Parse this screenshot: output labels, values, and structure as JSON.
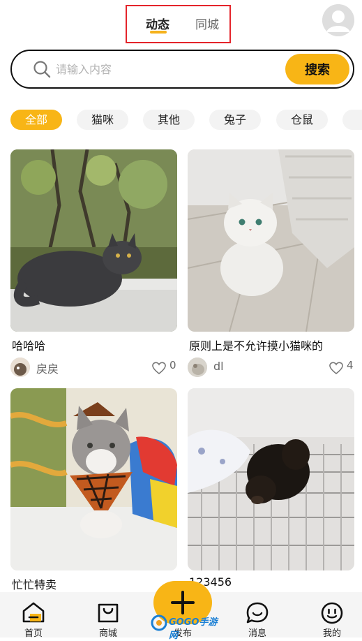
{
  "header": {
    "tabs": [
      {
        "label": "动态",
        "active": true
      },
      {
        "label": "同城",
        "active": false
      }
    ],
    "highlight_color": "#e4242b"
  },
  "search": {
    "placeholder": "请输入内容",
    "value": "",
    "button_label": "搜索"
  },
  "categories": [
    {
      "label": "全部",
      "active": true
    },
    {
      "label": "猫咪",
      "active": false
    },
    {
      "label": "其他",
      "active": false
    },
    {
      "label": "兔子",
      "active": false
    },
    {
      "label": "仓鼠",
      "active": false
    }
  ],
  "posts": [
    {
      "title": "哈哈哈",
      "author": "戻戻",
      "likes": "0",
      "photo": "grey long-haired cat on window ledge"
    },
    {
      "title": "原则上是不允许摸小猫咪的",
      "author": "dl",
      "likes": "4",
      "photo": "white persian cat on tiled floor"
    },
    {
      "title": "忙忙特卖",
      "author": "",
      "likes": "",
      "photo": "tabby kitten with plaid bandana"
    },
    {
      "title": "123456",
      "author": "",
      "likes": "",
      "photo": "black puppy on metal grate"
    }
  ],
  "bottom_nav": [
    {
      "label": "首页",
      "icon": "home-icon"
    },
    {
      "label": "商城",
      "icon": "shopping-bag-icon"
    },
    {
      "label": "发布",
      "icon": "plus-icon"
    },
    {
      "label": "消息",
      "icon": "chat-bubble-icon"
    },
    {
      "label": "我的",
      "icon": "smile-face-icon"
    }
  ],
  "watermark": "GOGO手游网",
  "colors": {
    "accent": "#f8b516",
    "chip_bg": "#f3f3f3",
    "nav_bg": "#f5f5f5"
  }
}
